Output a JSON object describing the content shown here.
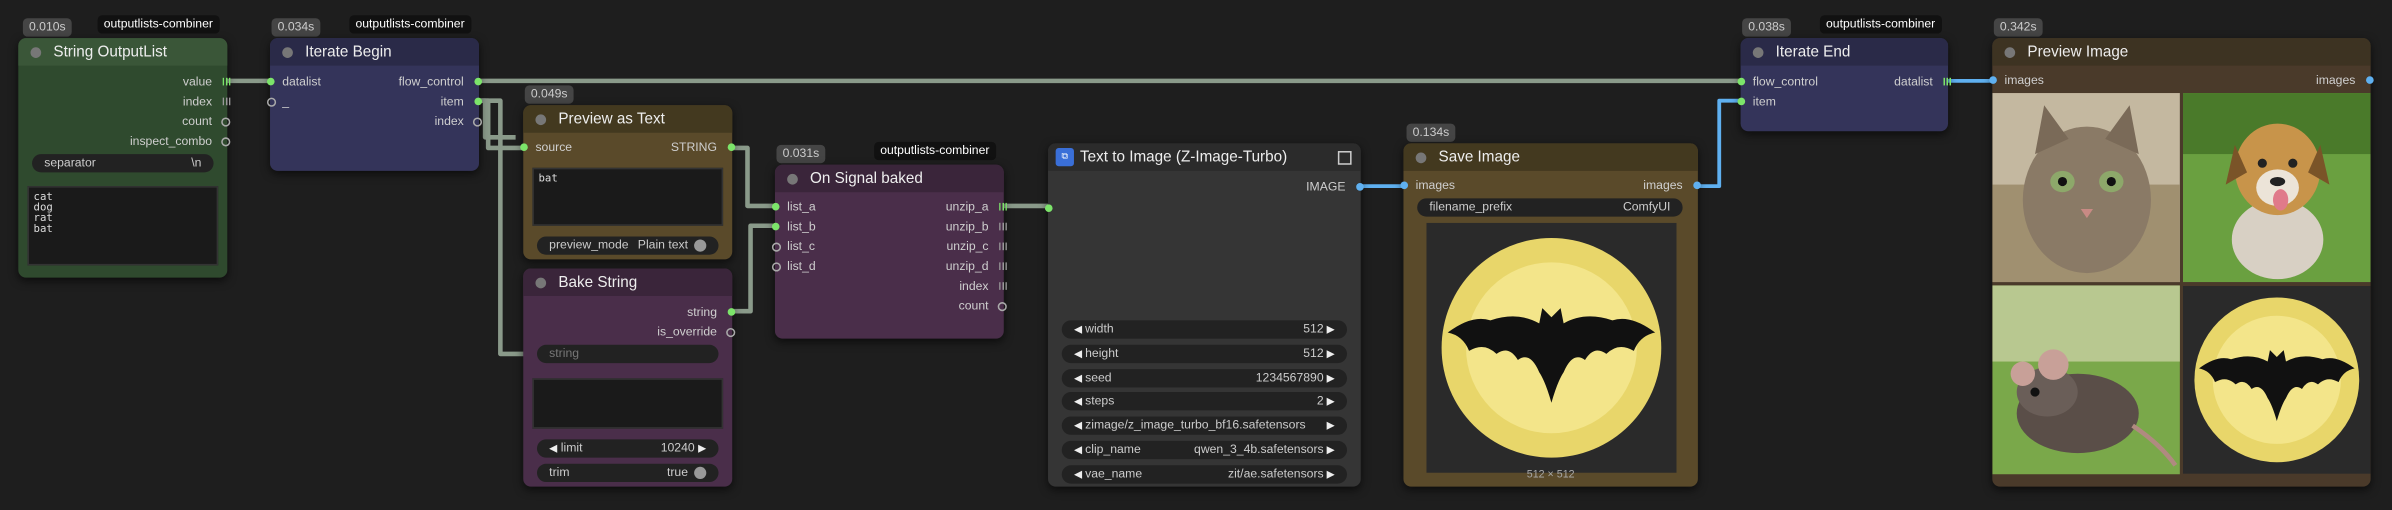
{
  "timings": {
    "string_output_list": "0.010s",
    "iterate_begin": "0.034s",
    "preview_as_text": "0.049s",
    "on_signal_baked": "0.031s",
    "save_image": "0.134s",
    "iterate_end": "0.038s",
    "preview_image": "0.342s"
  },
  "tags": {
    "string_output_list": "outputlists-combiner",
    "iterate_begin": "outputlists-combiner",
    "on_signal_baked": "outputlists-combiner",
    "iterate_end": "outputlists-combiner"
  },
  "string_output_list": {
    "title": "String OutputList",
    "outputs": [
      "value",
      "index",
      "count",
      "inspect_combo"
    ],
    "separator_label": "separator",
    "separator_value": "\\n",
    "text": "cat\ndog\nrat\nbat"
  },
  "iterate_begin": {
    "title": "Iterate Begin",
    "inputs": [
      "datalist",
      "_"
    ],
    "outputs": [
      "flow_control",
      "item",
      "index"
    ]
  },
  "preview_as_text": {
    "title": "Preview as Text",
    "input": "source",
    "output": "STRING",
    "text": "bat",
    "mode_label": "preview_mode",
    "mode_value": "Plain text"
  },
  "bake_string": {
    "title": "Bake String",
    "outputs": [
      "string",
      "is_override"
    ],
    "input": "string",
    "limit_label": "limit",
    "limit_value": "10240",
    "trim_label": "trim",
    "trim_value": "true"
  },
  "on_signal_baked": {
    "title": "On Signal baked",
    "inputs": [
      "list_a",
      "list_b",
      "list_c",
      "list_d"
    ],
    "outputs": [
      "unzip_a",
      "unzip_b",
      "unzip_c",
      "unzip_d",
      "index",
      "count"
    ]
  },
  "text_to_image": {
    "title": "Text to Image (Z-Image-Turbo)",
    "output": "IMAGE",
    "widgets": [
      {
        "label": "width",
        "value": "512"
      },
      {
        "label": "height",
        "value": "512"
      },
      {
        "label": "seed",
        "value": "1234567890"
      },
      {
        "label": "steps",
        "value": "2"
      },
      {
        "label": "zimage/z_image_turbo_bf16.safetensors",
        "value": ""
      },
      {
        "label": "clip_name",
        "value": "qwen_3_4b.safetensors"
      },
      {
        "label": "vae_name",
        "value": "zit/ae.safetensors"
      }
    ]
  },
  "save_image": {
    "title": "Save Image",
    "input": "images",
    "output": "images",
    "prefix_label": "filename_prefix",
    "prefix_value": "ComfyUI",
    "caption": "512 × 512"
  },
  "iterate_end": {
    "title": "Iterate End",
    "inputs": [
      "flow_control",
      "item"
    ],
    "output": "datalist"
  },
  "preview_image": {
    "title": "Preview Image",
    "input": "images",
    "output": "images"
  },
  "icons": [
    "node-collapse-icon",
    "list-socket-icon",
    "subgraph-icon",
    "expand-icon",
    "left-arrow-icon",
    "right-arrow-icon",
    "toggle-icon"
  ],
  "colors": {
    "background": "#1e1e1e",
    "green_node": "#2f4a2e",
    "blue_node": "#34345a",
    "brown_node": "#5a4a2a",
    "purple_node": "#4a2e4a",
    "gray_node": "#353535",
    "wire_gray": "#8a9a8a",
    "wire_blue": "#5fb0f0"
  }
}
